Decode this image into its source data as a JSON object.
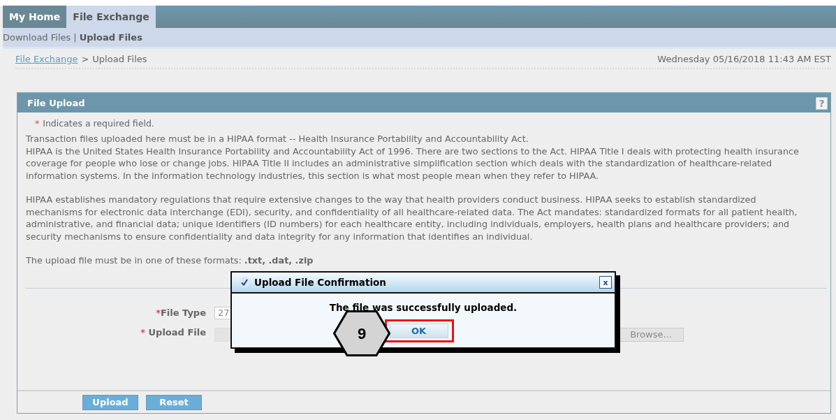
{
  "nav_tabs": [
    {
      "label": "My Home",
      "selected": false
    },
    {
      "label": "File Exchange",
      "selected": true
    }
  ],
  "sub_nav": [
    {
      "label": "Download Files",
      "selected": false
    },
    {
      "label": "Upload Files",
      "selected": true
    }
  ],
  "sub_nav_separator": "|",
  "breadcrumb": {
    "link": "File Exchange",
    "separator": ">",
    "current": "Upload Files"
  },
  "datetime": "Wednesday 05/16/2018 11:43 AM EST",
  "panel": {
    "title": "File Upload",
    "help": "?",
    "required_note": {
      "mark": "*",
      "text": "Indicates a required field."
    },
    "text_blocks": [
      [
        "Transaction files uploaded here must be in a HIPAA format -- Health Insurance Portability and Accountability Act.",
        "HIPAA is the United States Health Insurance Portability and Accountability Act of 1996. There are two sections to the Act. HIPAA Title I deals with protecting health insurance coverage for people who lose or change jobs. HIPAA Title II includes an administrative simplification section which deals with the standardization of healthcare-related information systems. In the information technology industries, this section is what most people mean when they refer to HIPAA."
      ],
      [
        "HIPAA establishes mandatory regulations that require extensive changes to the way that health providers conduct business. HIPAA seeks to establish standardized mechanisms for electronic data interchange (EDI), security, and confidentiality of all healthcare-related data. The Act mandates: standardized formats for all patient health, administrative, and financial data; unique identifiers (ID numbers) for each healthcare entity, including individuals, employers, health plans and healthcare providers; and security mechanisms to ensure confidentiality and data integrity for any information that identifies an individual."
      ],
      [
        "The upload file must be in one of these formats: **.txt, .dat, .zip**"
      ]
    ],
    "fields": [
      {
        "kind": "select",
        "mark": "*",
        "label": "File Type",
        "value": "27"
      },
      {
        "kind": "file",
        "mark": "* ",
        "label": "Upload File",
        "button": "Browse..."
      }
    ],
    "buttons": [
      "Upload",
      "Reset"
    ]
  },
  "dialog": {
    "title": "Upload File Confirmation",
    "close": "x",
    "message": "The file was successfully uploaded.",
    "button": "OK"
  },
  "callout": {
    "step": "9"
  }
}
